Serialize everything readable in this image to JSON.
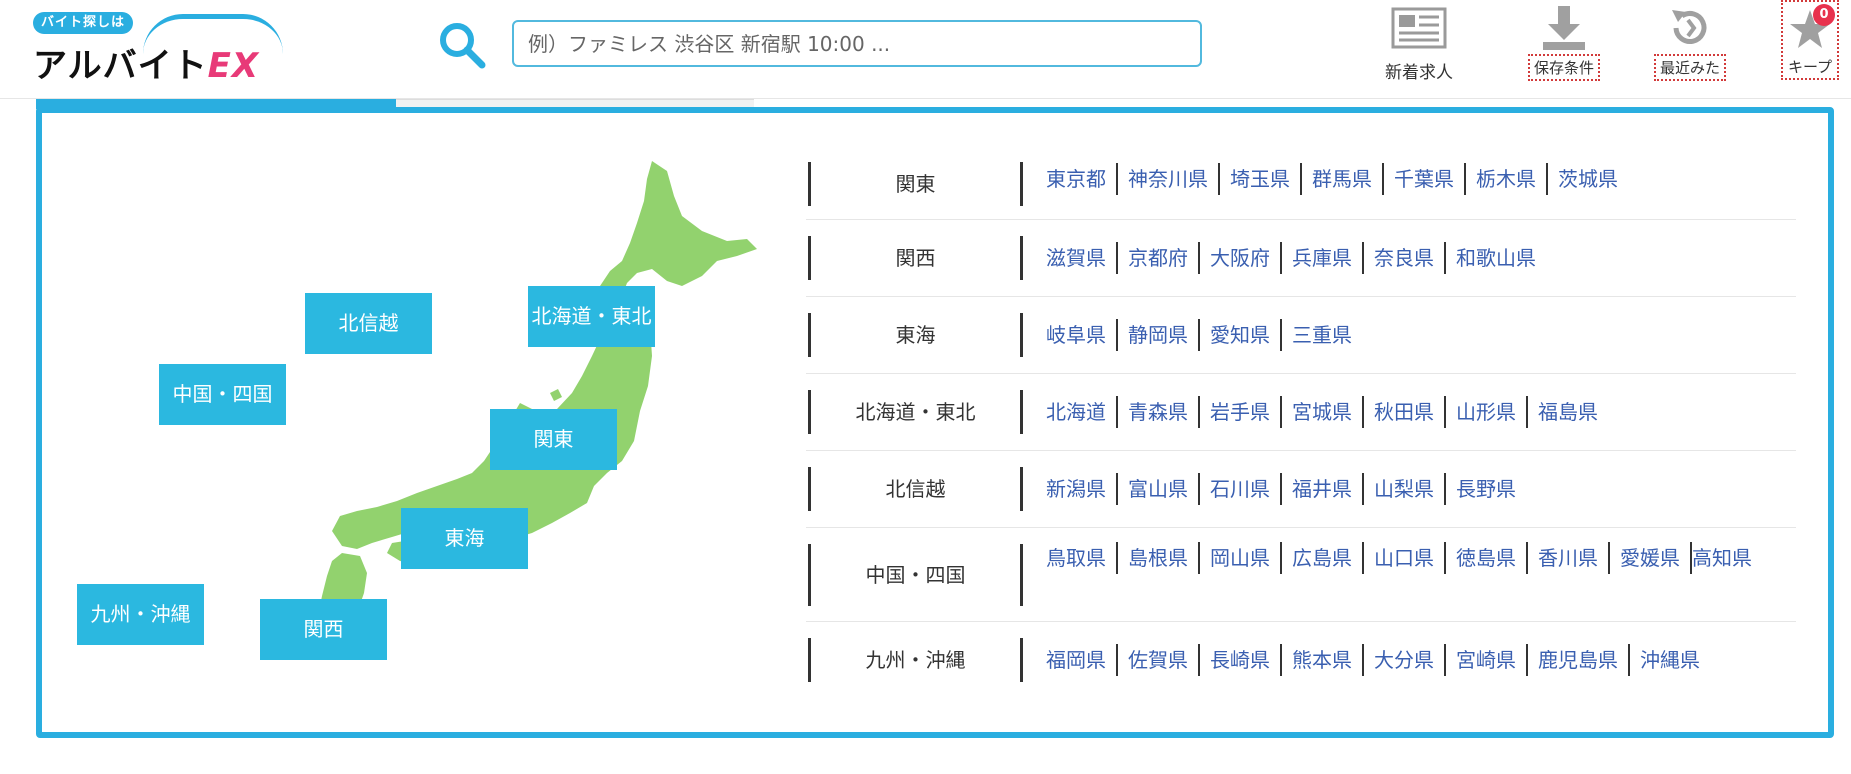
{
  "header": {
    "logo_tag": "バイト探しは",
    "logo_main": "アルバイト",
    "logo_ex": "EX",
    "search_placeholder": "例）ファミレス 渋谷区 新宿駅 10:00 ...",
    "nav": {
      "new_jobs": "新着求人",
      "saved_conditions": "保存条件",
      "recently_viewed": "最近みた",
      "keep": "キープ",
      "keep_count": "0"
    }
  },
  "map_buttons": {
    "hokushinetsu": "北信越",
    "hokkaido_tohoku": "北海道・東北",
    "chugoku_shikoku": "中国・四国",
    "kanto": "関東",
    "tokai": "東海",
    "kyushu_okinawa": "九州・沖縄",
    "kansai": "関西"
  },
  "regions": [
    {
      "name": "関東",
      "prefs": [
        "東京都",
        "神奈川県",
        "埼玉県",
        "群馬県",
        "千葉県",
        "栃木県",
        "茨城県"
      ]
    },
    {
      "name": "関西",
      "prefs": [
        "滋賀県",
        "京都府",
        "大阪府",
        "兵庫県",
        "奈良県",
        "和歌山県"
      ]
    },
    {
      "name": "東海",
      "prefs": [
        "岐阜県",
        "静岡県",
        "愛知県",
        "三重県"
      ]
    },
    {
      "name": "北海道・東北",
      "prefs": [
        "北海道",
        "青森県",
        "岩手県",
        "宮城県",
        "秋田県",
        "山形県",
        "福島県"
      ]
    },
    {
      "name": "北信越",
      "prefs": [
        "新潟県",
        "富山県",
        "石川県",
        "福井県",
        "山梨県",
        "長野県"
      ]
    },
    {
      "name": "中国・四国",
      "prefs": [
        "鳥取県",
        "島根県",
        "岡山県",
        "広島県",
        "山口県",
        "徳島県",
        "香川県",
        "愛媛県",
        "高知県"
      ]
    },
    {
      "name": "九州・沖縄",
      "prefs": [
        "福岡県",
        "佐賀県",
        "長崎県",
        "熊本県",
        "大分県",
        "宮崎県",
        "鹿児島県",
        "沖縄県"
      ]
    }
  ],
  "colors": {
    "accent": "#2aaee0",
    "map_fill": "#92d26e",
    "link": "#3a5fb0",
    "badge": "#e8324d"
  }
}
